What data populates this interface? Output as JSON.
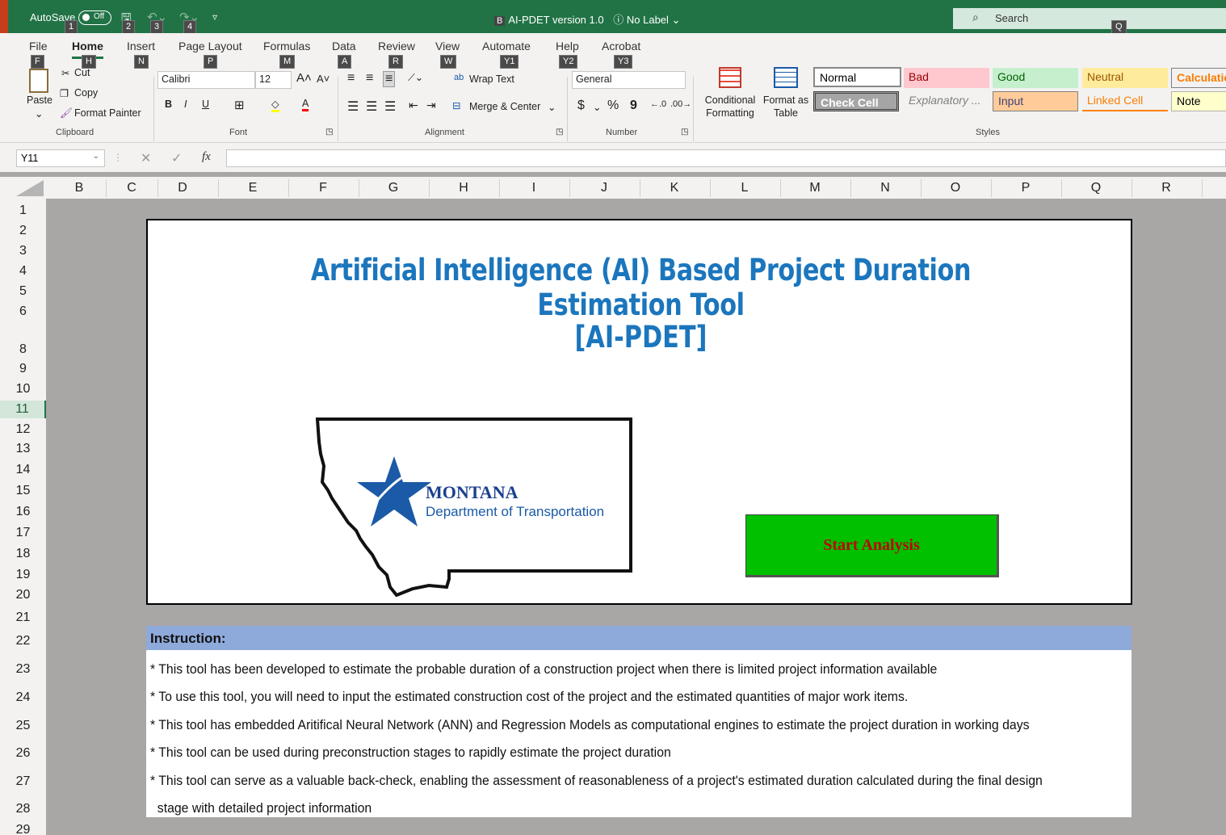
{
  "titlebar": {
    "autosave_label": "AutoSave",
    "autosave_state": "Off",
    "doc_badge": "B",
    "doc_title": "AI-PDET version 1.0",
    "label_text": "No Label",
    "search_placeholder": "Search",
    "keytips": [
      "1",
      "2",
      "3",
      "4"
    ],
    "search_keytip": "Q"
  },
  "ribbon": {
    "tabs": [
      {
        "label": "File",
        "keytip": "F"
      },
      {
        "label": "Home",
        "keytip": "H"
      },
      {
        "label": "Insert",
        "keytip": "N"
      },
      {
        "label": "Page Layout",
        "keytip": "P"
      },
      {
        "label": "Formulas",
        "keytip": "M"
      },
      {
        "label": "Data",
        "keytip": "A"
      },
      {
        "label": "Review",
        "keytip": "R"
      },
      {
        "label": "View",
        "keytip": "W"
      },
      {
        "label": "Automate",
        "keytip": "Y1"
      },
      {
        "label": "Help",
        "keytip": "Y2"
      },
      {
        "label": "Acrobat",
        "keytip": "Y3"
      }
    ],
    "clipboard": {
      "paste": "Paste",
      "cut": "Cut",
      "copy": "Copy",
      "format_painter": "Format Painter",
      "label": "Clipboard"
    },
    "font": {
      "name": "Calibri",
      "size": "12",
      "label": "Font",
      "bold": "B",
      "italic": "I",
      "underline": "U"
    },
    "alignment": {
      "wrap_text": "Wrap Text",
      "merge_center": "Merge & Center",
      "label": "Alignment"
    },
    "number": {
      "format": "General",
      "currency": "$",
      "percent": "%",
      "comma": "9",
      "label": "Number"
    },
    "styles": {
      "conditional_formatting": "Conditional Formatting",
      "format_as_table": "Format as Table",
      "label": "Styles",
      "cells": [
        {
          "label": "Normal",
          "bg": "#ffffff",
          "fg": "#000000"
        },
        {
          "label": "Bad",
          "bg": "#ffc7ce",
          "fg": "#9c0006"
        },
        {
          "label": "Good",
          "bg": "#c6efce",
          "fg": "#006100"
        },
        {
          "label": "Neutral",
          "bg": "#ffeb9c",
          "fg": "#9c5700"
        },
        {
          "label": "Calculation",
          "bg": "#f2f2f2",
          "fg": "#fa7d00"
        },
        {
          "label": "Check Cell",
          "bg": "#a5a5a5",
          "fg": "#ffffff"
        },
        {
          "label": "Explanatory ...",
          "bg": "#f3f2f1",
          "fg": "#7f7f7f"
        },
        {
          "label": "Input",
          "bg": "#ffcc99",
          "fg": "#3f3f76"
        },
        {
          "label": "Linked Cell",
          "bg": "#f3f2f1",
          "fg": "#fa7d00"
        },
        {
          "label": "Note",
          "bg": "#ffffcc",
          "fg": "#000000"
        }
      ]
    }
  },
  "formula_bar": {
    "cell_ref": "Y11",
    "fx": "fx",
    "value": ""
  },
  "columns": [
    "B",
    "C",
    "D",
    "E",
    "F",
    "G",
    "H",
    "I",
    "J",
    "K",
    "L",
    "M",
    "N",
    "O",
    "P",
    "Q",
    "R"
  ],
  "rows": [
    "1",
    "2",
    "3",
    "4",
    "5",
    "6",
    "8",
    "9",
    "10",
    "11",
    "12",
    "13",
    "14",
    "15",
    "16",
    "17",
    "18",
    "19",
    "20",
    "21",
    "22",
    "23",
    "24",
    "25",
    "26",
    "27",
    "28",
    "29"
  ],
  "selected_row": "11",
  "sheet": {
    "title_line1": "Artificial Intelligence (AI) Based Project Duration Estimation Tool",
    "title_line2": "[AI-PDET]",
    "logo_name": "MONTANA",
    "logo_subtitle": "Department of Transportation",
    "start_button": "Start Analysis",
    "instruction_header": "Instruction:",
    "instructions": [
      "* This tool has been developed to estimate the probable duration of a construction project when there is limited project information available",
      "* To use this tool, you will need to input the estimated construction cost of the project and the estimated quantities of major work items.",
      "* This tool has embedded Aritifical Neural Network (ANN) and Regression Models as computational engines to estimate the project duration in working days",
      "* This tool can be used during preconstruction stages to rapidly estimate the project duration",
      "* This tool can serve as a valuable back-check, enabling the assessment of reasonableness of a project's estimated duration calculated during the final design",
      "  stage with detailed project information"
    ]
  },
  "colors": {
    "excel_green": "#217346",
    "title_blue": "#1b76bd",
    "button_green": "#00c000",
    "button_text": "#c00000",
    "instruction_header_bg": "#8eaadb"
  }
}
